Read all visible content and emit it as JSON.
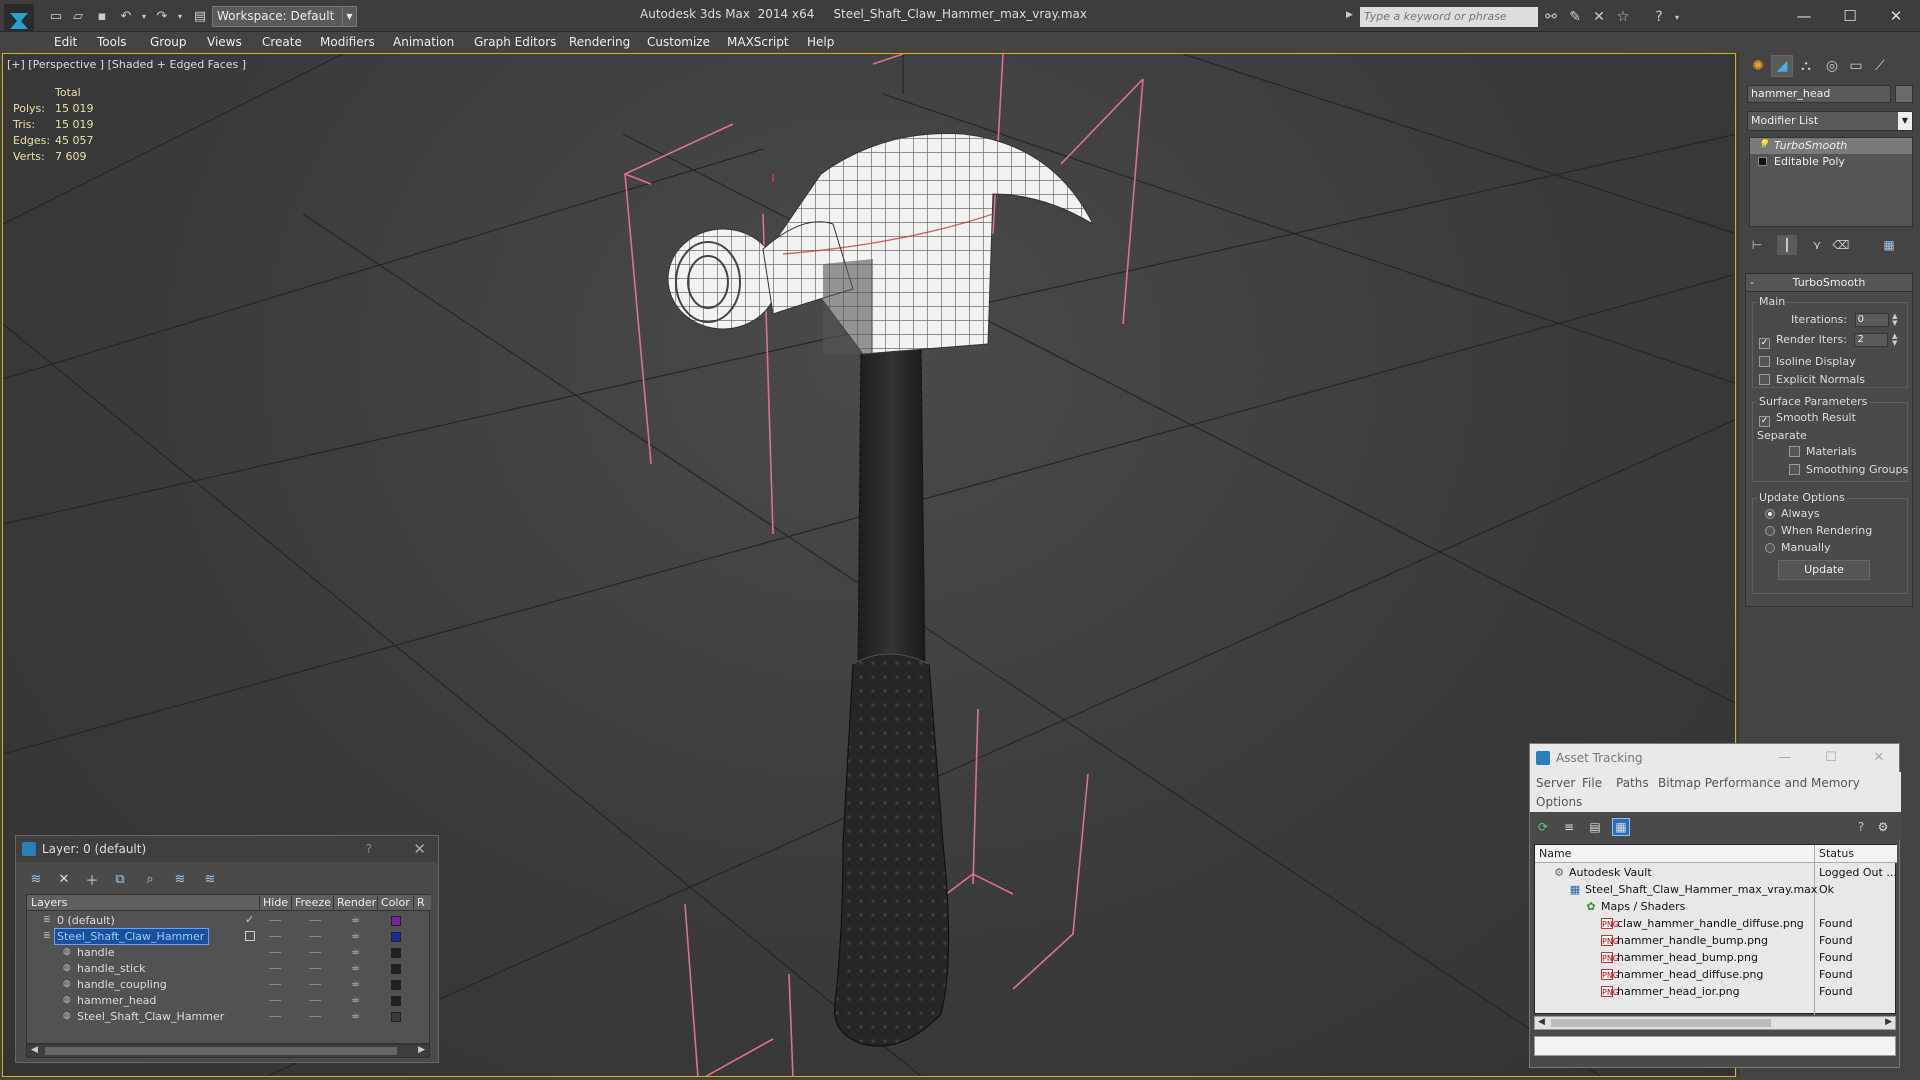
{
  "titlebar": {
    "workspace": "Workspace: Default",
    "app_title": "Autodesk 3ds Max  2014 x64",
    "file_title": "Steel_Shaft_Claw_Hammer_max_vray.max",
    "search_placeholder": "Type a keyword or phrase"
  },
  "menu": [
    "Edit",
    "Tools",
    "Group",
    "Views",
    "Create",
    "Modifiers",
    "Animation",
    "Graph Editors",
    "Rendering",
    "Customize",
    "MAXScript",
    "Help"
  ],
  "viewport": {
    "label": "[+] [Perspective ] [Shaded + Edged Faces ]",
    "stats_header": "Total",
    "stats": [
      {
        "name": "Polys:",
        "value": "15 019"
      },
      {
        "name": "Tris:",
        "value": "15 019"
      },
      {
        "name": "Edges:",
        "value": "45 057"
      },
      {
        "name": "Verts:",
        "value": "7 609"
      }
    ]
  },
  "command_panel": {
    "object_name": "hammer_head",
    "modifier_list": "Modifier List",
    "stack": [
      "TurboSmooth",
      "Editable Poly"
    ],
    "rollout_title": "TurboSmooth",
    "main_label": "Main",
    "iterations_label": "Iterations:",
    "iterations_value": "0",
    "render_iters_label": "Render Iters:",
    "render_iters_value": "2",
    "isoline_label": "Isoline Display",
    "explicit_normals_label": "Explicit Normals",
    "surface_params_label": "Surface Parameters",
    "smooth_result_label": "Smooth Result",
    "separate_label": "Separate",
    "materials_label": "Materials",
    "smoothing_groups_label": "Smoothing Groups",
    "update_options_label": "Update Options",
    "always_label": "Always",
    "when_rendering_label": "When Rendering",
    "manually_label": "Manually",
    "update_button": "Update"
  },
  "layer_dialog": {
    "title": "Layer: 0 (default)",
    "help": "?",
    "columns": {
      "layers": "Layers",
      "hide": "Hide",
      "freeze": "Freeze",
      "render": "Render",
      "color": "Color",
      "r": "R"
    },
    "rows": [
      {
        "name": "0 (default)",
        "color": "#7a1fa8",
        "selected": false,
        "indent": 0
      },
      {
        "name": "Steel_Shaft_Claw_Hammer",
        "color": "#1a2aa0",
        "selected": true,
        "indent": 0
      },
      {
        "name": "handle",
        "color": "#222222",
        "selected": false,
        "indent": 1
      },
      {
        "name": "handle_stick",
        "color": "#222222",
        "selected": false,
        "indent": 1
      },
      {
        "name": "handle_coupling",
        "color": "#222222",
        "selected": false,
        "indent": 1
      },
      {
        "name": "hammer_head",
        "color": "#222222",
        "selected": false,
        "indent": 1
      },
      {
        "name": "Steel_Shaft_Claw_Hammer",
        "color": "#3a3a3a",
        "selected": false,
        "indent": 1
      }
    ]
  },
  "asset_tracking": {
    "title": "Asset Tracking",
    "menu": [
      "Server",
      "File",
      "Paths",
      "Bitmap Performance and Memory",
      "Options"
    ],
    "columns": {
      "name": "Name",
      "status": "Status"
    },
    "rows": [
      {
        "name": "Autodesk Vault",
        "status": "Logged Out ...",
        "level": 0,
        "icon": "vault"
      },
      {
        "name": "Steel_Shaft_Claw_Hammer_max_vray.max",
        "status": "Ok",
        "level": 1,
        "icon": "max"
      },
      {
        "name": "Maps / Shaders",
        "status": "",
        "level": 2,
        "icon": "maps"
      },
      {
        "name": "claw_hammer_handle_diffuse.png",
        "status": "Found",
        "level": 3,
        "icon": "png"
      },
      {
        "name": "hammer_handle_bump.png",
        "status": "Found",
        "level": 3,
        "icon": "png"
      },
      {
        "name": "hammer_head_bump.png",
        "status": "Found",
        "level": 3,
        "icon": "png"
      },
      {
        "name": "hammer_head_diffuse.png",
        "status": "Found",
        "level": 3,
        "icon": "png"
      },
      {
        "name": "hammer_head_ior.png",
        "status": "Found",
        "level": 3,
        "icon": "png"
      }
    ]
  }
}
